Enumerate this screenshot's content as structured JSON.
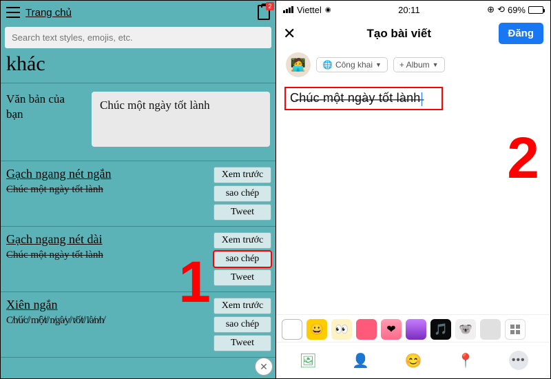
{
  "left": {
    "home_link": "Trang chủ",
    "notification_count": "2",
    "search_placeholder": "Search text styles, emojis, etc.",
    "heading": "khác",
    "input_label": "Văn bản của bạn",
    "input_value": "Chúc một ngày tốt lành",
    "styles": [
      {
        "name": "Gạch ngang nét ngắn",
        "sample": "Chúc một ngày tốt lành",
        "sample_class": "strike-short",
        "buttons": [
          "Xem trước",
          "sao chép",
          "Tweet"
        ],
        "highlight_index": -1
      },
      {
        "name": "Gạch ngang nét dài",
        "sample": "Chúc một ngày tốt lành",
        "sample_class": "strike-long",
        "buttons": [
          "Xem trước",
          "sao chép",
          "Tweet"
        ],
        "highlight_index": 1
      },
      {
        "name": "Xiên ngắn",
        "sample": "C̸h̸ú̸c̸/m̸ộ̸t̸/n̸g̸à̸y̸/t̸ố̸t̸/l̸à̸n̸h̸",
        "sample_class": "",
        "buttons": [
          "Xem trước",
          "sao chép",
          "Tweet"
        ],
        "highlight_index": -1
      }
    ],
    "step_number": "1",
    "close_icon": "✕"
  },
  "right": {
    "status": {
      "carrier": "Viettel",
      "wifi": "⚫",
      "time": "20:11",
      "alarm": "⊙",
      "lock": "⟳",
      "battery_pct": "69%"
    },
    "close": "✕",
    "title": "Tạo bài viết",
    "post_btn": "Đăng",
    "avatar_emoji": "🧑‍💻",
    "audience_chip": "Công khai",
    "album_chip": "+ Album",
    "post_text": "C̶h̶ú̶c̶ ̶m̶ộ̶t̶ ̶n̶g̶à̶y̶ ̶t̶ố̶t̶ ̶l̶à̶n̶h̶",
    "step_number": "2",
    "bg_options": [
      {
        "style": "background:#fff;",
        "class": "bg-outline",
        "name": "bg-none"
      },
      {
        "style": "background:#ffcc00;",
        "emoji": "😀",
        "name": "bg-yellow-smile"
      },
      {
        "style": "background:#fff3c4;",
        "emoji": "👀",
        "name": "bg-eyes"
      },
      {
        "style": "background:#ff5a7a;",
        "name": "bg-pink"
      },
      {
        "style": "background:linear-gradient(#ff9bb3,#ff6b8a);",
        "emoji": "❤",
        "name": "bg-heart"
      },
      {
        "style": "background:linear-gradient(#c77dff,#7b2cbf);",
        "name": "bg-purple"
      },
      {
        "style": "background:#0a0a0a;",
        "emoji": "🎵",
        "name": "bg-black-music"
      },
      {
        "style": "background:#f0f0f0;",
        "emoji": "🐨",
        "name": "bg-koala"
      },
      {
        "style": "background:#e0e0e0;",
        "name": "bg-gray"
      }
    ],
    "bottom_icons": [
      {
        "glyph": "🖼",
        "color": "#45bd62",
        "name": "photo-icon"
      },
      {
        "glyph": "👤",
        "color": "#1877f2",
        "name": "tag-person-icon"
      },
      {
        "glyph": "😊",
        "color": "#f7b928",
        "name": "feeling-icon"
      },
      {
        "glyph": "📍",
        "color": "#f5533d",
        "name": "location-icon"
      }
    ],
    "more": "•••"
  }
}
